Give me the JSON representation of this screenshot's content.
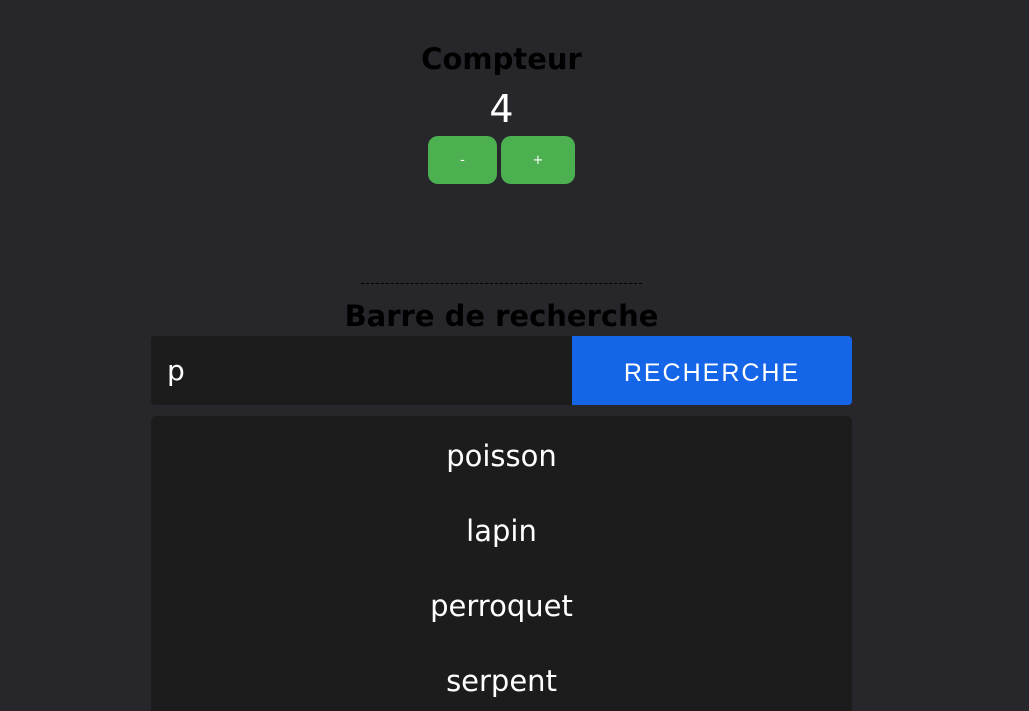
{
  "counter": {
    "title": "Compteur",
    "value": "4",
    "decrement_label": "-",
    "increment_label": "+"
  },
  "search": {
    "title": "Barre de recherche",
    "input_value": "p",
    "button_label": "RECHERCHE",
    "results": [
      {
        "label": "poisson"
      },
      {
        "label": "lapin"
      },
      {
        "label": "perroquet"
      },
      {
        "label": "serpent"
      }
    ]
  },
  "colors": {
    "background": "#27262b",
    "counter_button": "#4caf50",
    "search_button": "#1565e8",
    "panel": "#1c1c1c"
  }
}
